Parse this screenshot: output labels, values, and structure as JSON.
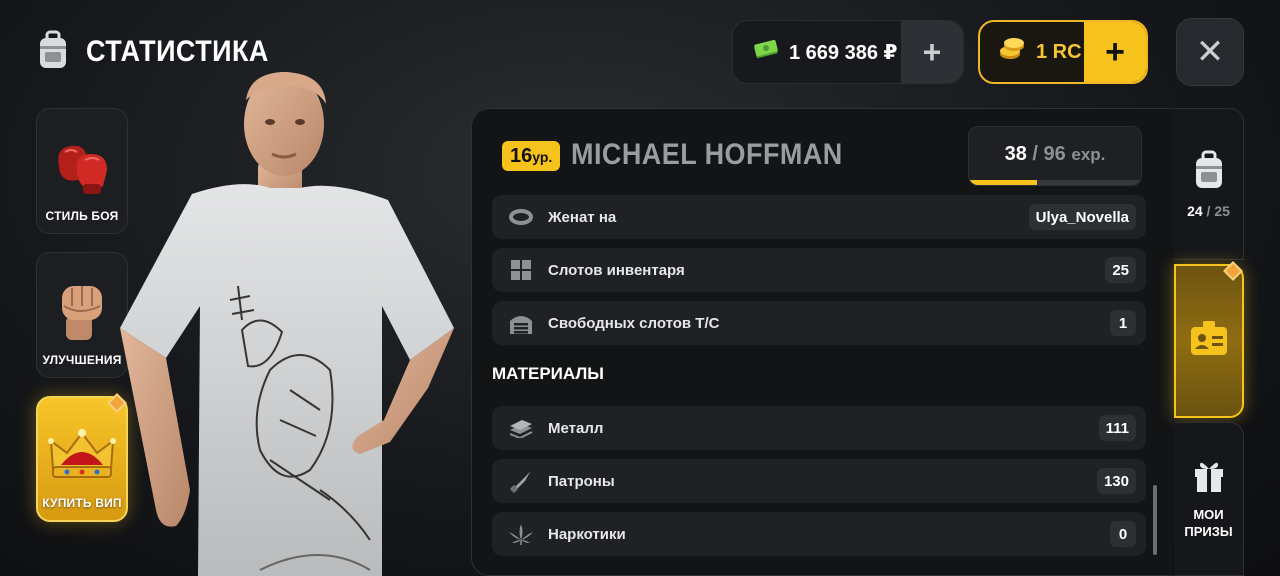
{
  "header": {
    "title": "СТАТИСТИКА",
    "title_icon": "backpack-icon",
    "money": {
      "amount": "1 669 386 ₽",
      "icon": "cash-icon",
      "add_label": "+"
    },
    "rc": {
      "amount": "1 RC",
      "icon": "coins-icon",
      "add_label": "+"
    },
    "close_label": "✕"
  },
  "side_menu": [
    {
      "label": "СТИЛЬ БОЯ",
      "icon": "boxing-gloves-icon"
    },
    {
      "label": "УЛУЧШЕНИЯ",
      "icon": "fist-icon"
    },
    {
      "label": "КУПИТЬ ВИП",
      "icon": "crown-icon",
      "highlighted": true
    }
  ],
  "profile": {
    "level": "16",
    "level_suffix": "ур.",
    "name": "MICHAEL HOFFMAN",
    "exp_current": "38",
    "exp_sep": "/",
    "exp_max": "96",
    "exp_unit": "exp.",
    "exp_progress": 0.396
  },
  "stats": [
    {
      "label": "Женат на",
      "value": "Ulya_Novella",
      "icon": "ring-icon"
    },
    {
      "label": "Слотов инвентаря",
      "value": "25",
      "icon": "grid-icon"
    },
    {
      "label": "Свободных слотов Т/С",
      "value": "1",
      "icon": "garage-icon"
    }
  ],
  "materials_title": "МАТЕРИАЛЫ",
  "materials": [
    {
      "label": "Металл",
      "value": "111",
      "icon": "metal-icon"
    },
    {
      "label": "Патроны",
      "value": "130",
      "icon": "bullet-icon"
    },
    {
      "label": "Наркотики",
      "value": "0",
      "icon": "leaf-icon"
    }
  ],
  "right_tabs": {
    "inventory": {
      "icon": "backpack-icon",
      "current": "24",
      "sep": "/",
      "max": "25"
    },
    "card": {
      "icon": "id-card-icon"
    },
    "prizes": {
      "icon": "gift-icon",
      "label": "МОИ ПРИЗЫ"
    }
  },
  "colors": {
    "accent": "#f5c31c",
    "money": "#7dd54a",
    "panel": "#121416",
    "row": "#1f2124"
  }
}
